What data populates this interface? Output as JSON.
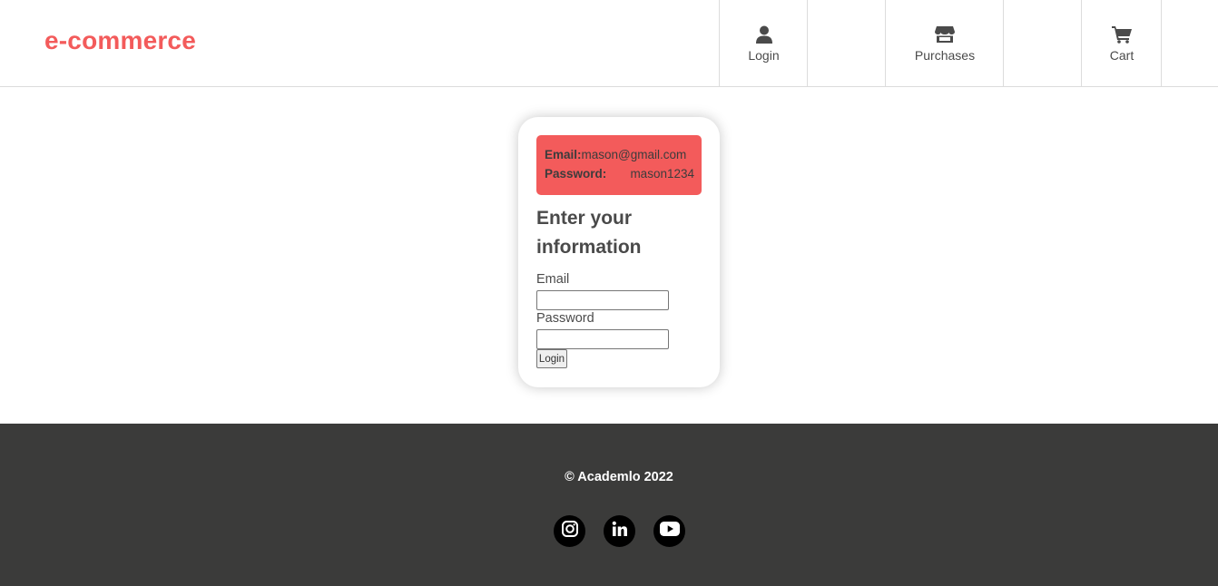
{
  "header": {
    "brand": "e-commerce",
    "nav": [
      {
        "label": "Login",
        "icon": "user-icon"
      },
      {
        "label": "Purchases",
        "icon": "store-icon"
      },
      {
        "label": "Cart",
        "icon": "cart-icon"
      }
    ]
  },
  "login_card": {
    "credentials": {
      "email_label": "Email:",
      "email_value": "mason@gmail.com",
      "password_label": "Password:",
      "password_value": "mason1234"
    },
    "title": "Enter your information",
    "email_label": "Email",
    "email_value": "",
    "password_label": "Password",
    "password_value": "",
    "submit_label": "Login"
  },
  "footer": {
    "copyright": "© Academlo 2022",
    "social": [
      {
        "icon": "instagram-icon"
      },
      {
        "icon": "linkedin-icon"
      },
      {
        "icon": "youtube-icon"
      }
    ]
  },
  "colors": {
    "accent": "#f35b5b",
    "footer_bg": "#3b3b3a",
    "text": "#4a4a4a"
  }
}
